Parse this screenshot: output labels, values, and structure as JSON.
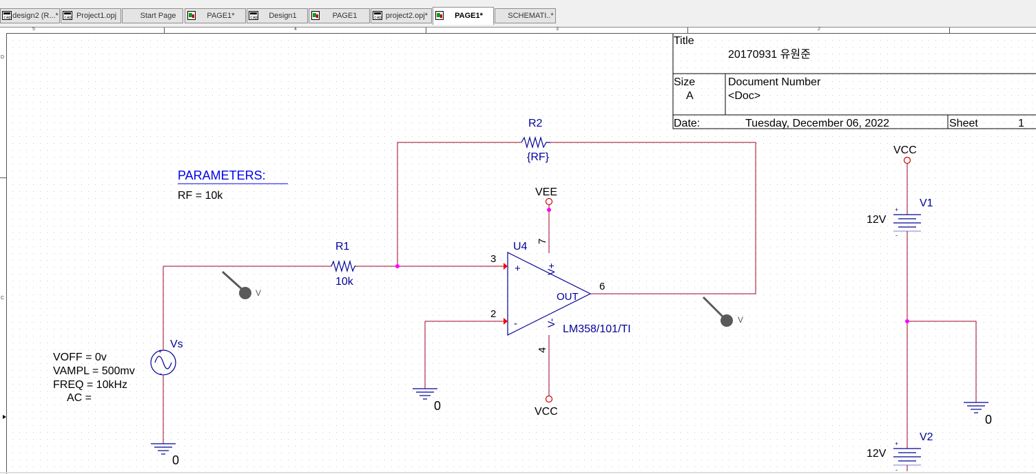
{
  "tabs": [
    {
      "label": "design2 (R...*",
      "icon": "capture-project-icon"
    },
    {
      "label": "Project1.opj",
      "icon": "capture-project-icon"
    },
    {
      "label": "Start Page",
      "icon": ""
    },
    {
      "label": "PAGE1*",
      "icon": "schematic-page-icon"
    },
    {
      "label": "Design1",
      "icon": "capture-project-icon"
    },
    {
      "label": "PAGE1",
      "icon": "schematic-page-icon"
    },
    {
      "label": "project2.opj*",
      "icon": "capture-project-icon"
    },
    {
      "label": "PAGE1*",
      "icon": "schematic-page-icon",
      "active": true
    },
    {
      "label": "SCHEMATI..*",
      "icon": ""
    }
  ],
  "ruler": {
    "top": [
      "5",
      "4",
      "3",
      "2"
    ],
    "left": [
      "D",
      "C"
    ]
  },
  "title_block": {
    "title_label": "Title",
    "title_value": "20170931 유원준",
    "size_label": "Size",
    "size_value": "A",
    "docnum_label": "Document Number",
    "docnum_value": "<Doc>",
    "date_label": "Date:",
    "date_value": "Tuesday, December 06, 2022",
    "sheet_label": "Sheet",
    "sheet_value": "1"
  },
  "params": {
    "header": "PARAMETERS:",
    "line": "RF = 10k"
  },
  "source": {
    "ref": "Vs",
    "voff": "VOFF = 0v",
    "vampl": "VAMPL = 500mv",
    "freq": "FREQ = 10kHz",
    "ac": "AC ="
  },
  "r1": {
    "ref": "R1",
    "value": "10k"
  },
  "r2": {
    "ref": "R2",
    "value": "{RF}"
  },
  "opamp": {
    "ref": "U4",
    "part": "LM358/101/TI",
    "pin_plus": "3",
    "pin_minus": "2",
    "pin_out": "6",
    "pin_vpos": "7",
    "pin_vneg": "4",
    "plus_sign": "+",
    "minus_sign": "-",
    "out_label": "OUT",
    "vpos_label": "V+",
    "vneg_label": "V-"
  },
  "vee_label": "VEE",
  "vcc_bottom_label": "VCC",
  "vcc_right_label": "VCC",
  "v1": {
    "ref": "V1",
    "value": "12V",
    "plus": "+",
    "minus": "-"
  },
  "v2": {
    "ref": "V2",
    "value": "12V",
    "plus": "+",
    "minus": "-"
  },
  "probe_label": "V",
  "ground_label": "0",
  "colors": {
    "wire": "#a00026",
    "part": "#000099",
    "text": "#000000",
    "probe": "#5a5a5a",
    "junction": "#ff00ff",
    "pin": "#ff0000",
    "power_pin": "#cc0000"
  }
}
